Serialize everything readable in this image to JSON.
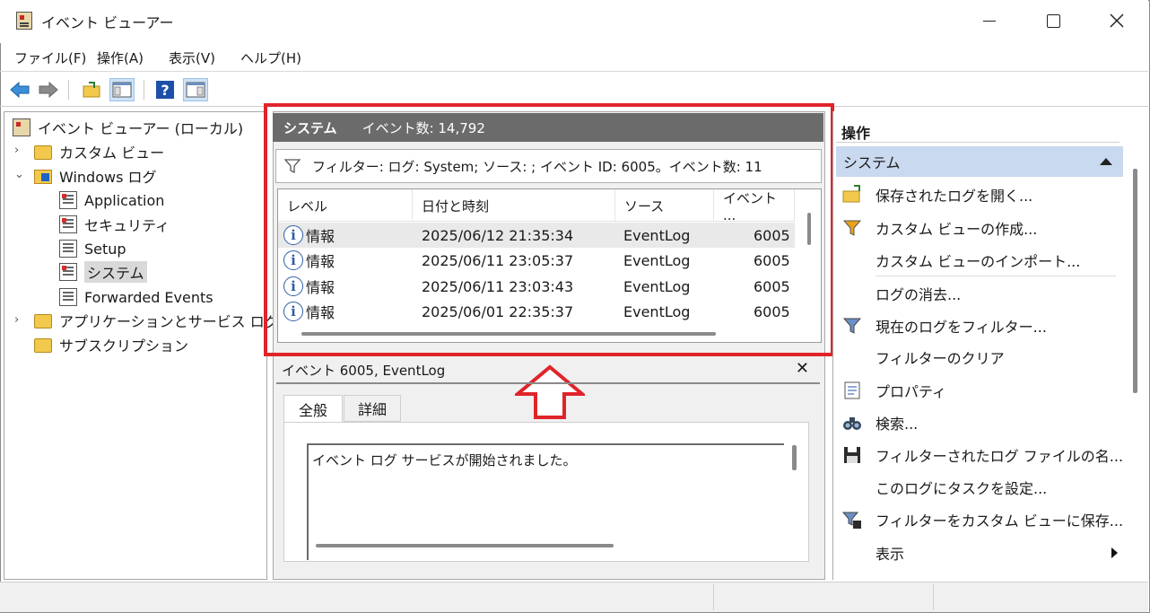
{
  "window": {
    "title": "イベント ビューアー"
  },
  "menu": [
    {
      "label": "ファイル(F)"
    },
    {
      "label": "操作(A)"
    },
    {
      "label": "表示(V)"
    },
    {
      "label": "ヘルプ(H)"
    }
  ],
  "toolbar": {
    "buttons": [
      "back-arrow-icon",
      "forward-arrow-icon",
      "open-folder-icon",
      "show-tree-icon",
      "help-icon",
      "show-actions-icon"
    ]
  },
  "tree": {
    "root": "イベント ビューアー (ローカル)",
    "custom_views": "カスタム ビュー",
    "windows_logs": "Windows ログ",
    "logs": [
      "Application",
      "セキュリティ",
      "Setup",
      "システム",
      "Forwarded Events"
    ],
    "app_services": "アプリケーションとサービス ログ",
    "subscriptions": "サブスクリプション"
  },
  "center": {
    "log_name": "システム",
    "event_count": "イベント数: 14,792",
    "filter_text": "フィルター: ログ: System; ソース: ; イベント ID: 6005。イベント数: 11",
    "columns": [
      "レベル",
      "日付と時刻",
      "ソース",
      "イベント ..."
    ],
    "rows": [
      {
        "level": "情報",
        "datetime": "2025/06/12 21:35:34",
        "source": "EventLog",
        "event_id": "6005"
      },
      {
        "level": "情報",
        "datetime": "2025/06/11 23:05:37",
        "source": "EventLog",
        "event_id": "6005"
      },
      {
        "level": "情報",
        "datetime": "2025/06/11 23:03:43",
        "source": "EventLog",
        "event_id": "6005"
      },
      {
        "level": "情報",
        "datetime": "2025/06/01 22:35:37",
        "source": "EventLog",
        "event_id": "6005"
      }
    ],
    "detail_title": "イベント 6005, EventLog",
    "tabs": [
      "全般",
      "詳細"
    ],
    "description": "イベント ログ サービスが開始されました。"
  },
  "actions": {
    "title": "操作",
    "section": "システム",
    "items": [
      {
        "label": "保存されたログを開く...",
        "icon": "open-saved-log-icon"
      },
      {
        "label": "カスタム ビューの作成...",
        "icon": "create-view-filter-icon"
      },
      {
        "label": "カスタム ビューのインポート...",
        "icon": ""
      },
      {
        "label": "ログの消去...",
        "icon": ""
      },
      {
        "label": "現在のログをフィルター...",
        "icon": "filter-icon"
      },
      {
        "label": "フィルターのクリア",
        "icon": ""
      },
      {
        "label": "プロパティ",
        "icon": "properties-icon"
      },
      {
        "label": "検索...",
        "icon": "binoculars-icon"
      },
      {
        "label": "フィルターされたログ ファイルの名...",
        "icon": "save-icon"
      },
      {
        "label": "このログにタスクを設定...",
        "icon": ""
      },
      {
        "label": "フィルターをカスタム ビューに保存...",
        "icon": "save-filter-icon"
      },
      {
        "label": "表示",
        "icon": ""
      }
    ]
  },
  "colors": {
    "highlight": "#e0242a",
    "section_bg": "#c9d9ef",
    "header_bg": "#6b6b6b"
  }
}
